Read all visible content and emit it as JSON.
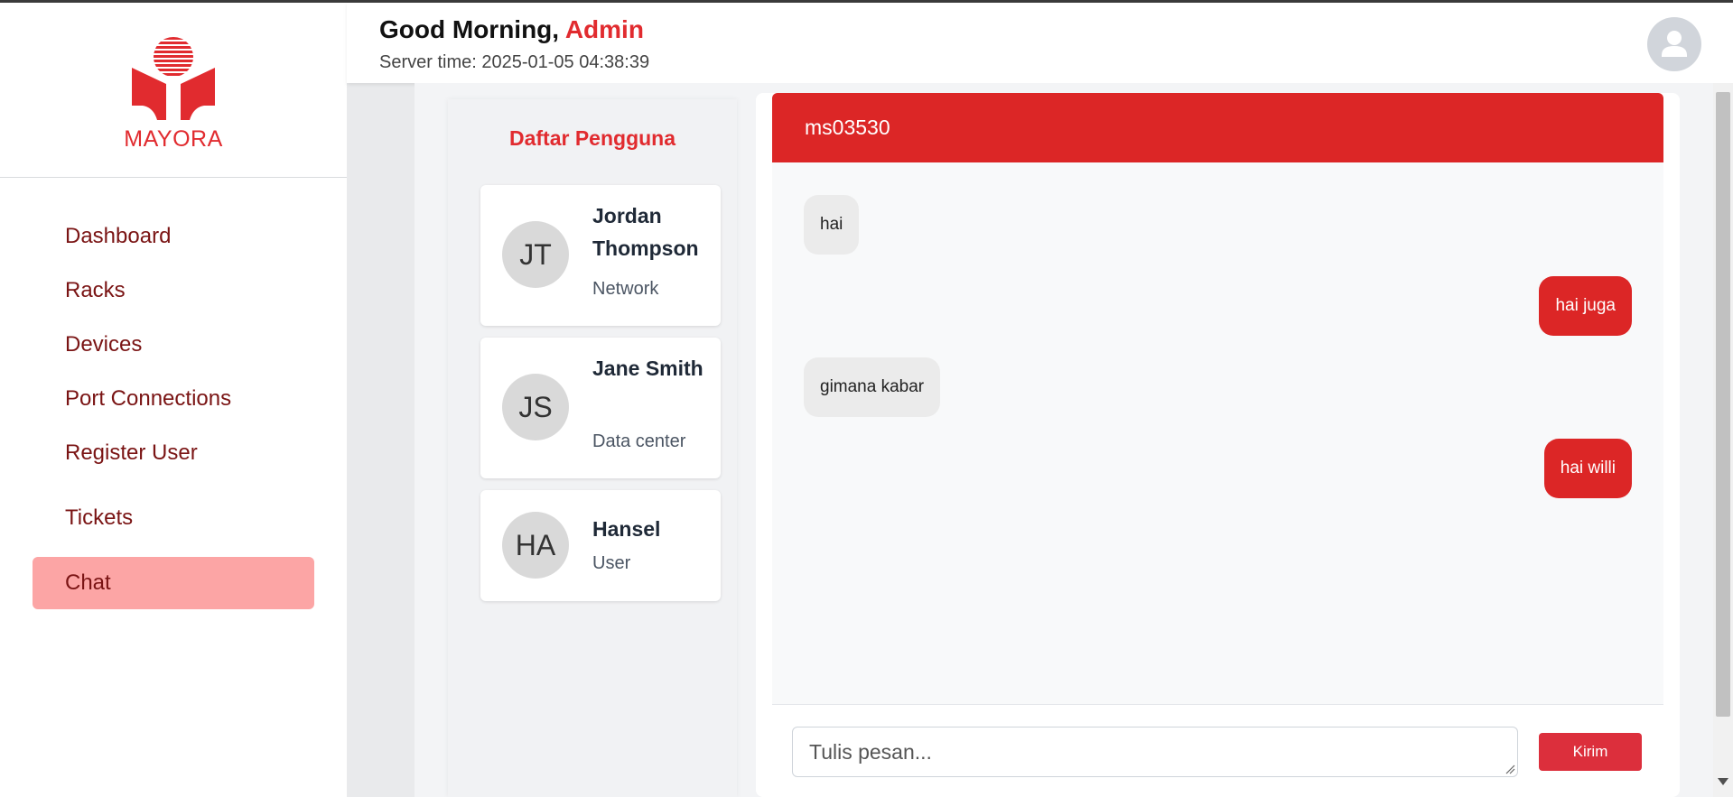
{
  "brand": {
    "name": "MAYORA",
    "color": "#e12b2f"
  },
  "sidebar": {
    "items": [
      {
        "label": "Dashboard",
        "active": false
      },
      {
        "label": "Racks",
        "active": false
      },
      {
        "label": "Devices",
        "active": false
      },
      {
        "label": "Port Connections",
        "active": false
      },
      {
        "label": "Register User",
        "active": false
      },
      {
        "label": "Tickets",
        "active": false
      },
      {
        "label": "Chat",
        "active": true
      }
    ]
  },
  "header": {
    "greeting": "Good Morning,",
    "username": "Admin",
    "server_time": "Server time: 2025-01-05 04:38:39",
    "avatar_icon": "user-avatar-icon"
  },
  "users_panel": {
    "title": "Daftar Pengguna",
    "users": [
      {
        "initials": "JT",
        "name": "Jordan Thompson",
        "role": "Network"
      },
      {
        "initials": "JS",
        "name": "Jane Smith",
        "role": "Data center"
      },
      {
        "initials": "HA",
        "name": "Hansel",
        "role": "User"
      }
    ]
  },
  "chat": {
    "title": "ms03530",
    "messages": [
      {
        "text": "hai",
        "direction": "in"
      },
      {
        "text": "hai juga",
        "direction": "out"
      },
      {
        "text": "gimana kabar",
        "direction": "in"
      },
      {
        "text": "hai willi",
        "direction": "out"
      }
    ],
    "input_placeholder": "Tulis pesan...",
    "send_label": "Kirim"
  }
}
